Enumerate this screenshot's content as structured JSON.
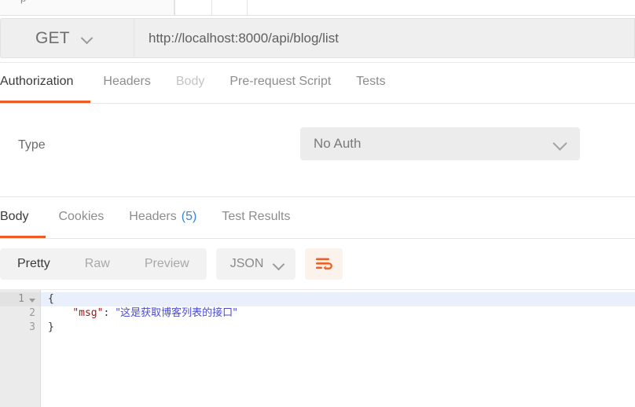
{
  "top_strip": {
    "ghost_text": "p"
  },
  "request": {
    "method": "GET",
    "url": "http://localhost:8000/api/blog/list",
    "tabs": [
      {
        "label": "Authorization",
        "state": "active"
      },
      {
        "label": "Headers",
        "state": "normal"
      },
      {
        "label": "Body",
        "state": "dim"
      },
      {
        "label": "Pre-request Script",
        "state": "normal"
      },
      {
        "label": "Tests",
        "state": "normal"
      }
    ]
  },
  "authorization": {
    "type_label": "Type",
    "selected_type": "No Auth"
  },
  "response": {
    "tabs": [
      {
        "label": "Body",
        "state": "active",
        "count": ""
      },
      {
        "label": "Cookies",
        "state": "normal",
        "count": ""
      },
      {
        "label": "Headers",
        "state": "normal",
        "count": "(5)"
      },
      {
        "label": "Test Results",
        "state": "normal",
        "count": ""
      }
    ],
    "format_modes": [
      {
        "label": "Pretty",
        "state": "active"
      },
      {
        "label": "Raw",
        "state": "normal"
      },
      {
        "label": "Preview",
        "state": "normal"
      }
    ],
    "language": "JSON",
    "wrap_icon": "word-wrap-icon",
    "body": {
      "line_numbers": [
        "1",
        "2",
        "3"
      ],
      "lines": [
        {
          "indent": "",
          "segments": [
            {
              "text": "{",
              "type": "punct"
            }
          ]
        },
        {
          "indent": "    ",
          "segments": [
            {
              "text": "\"msg\"",
              "type": "key"
            },
            {
              "text": ": ",
              "type": "punct"
            },
            {
              "text": "\"这是获取博客列表的接口\"",
              "type": "str"
            }
          ]
        },
        {
          "indent": "",
          "segments": [
            {
              "text": "}",
              "type": "punct"
            }
          ]
        }
      ]
    }
  },
  "colors": {
    "accent": "#ef5b25",
    "link": "#3a86d6",
    "json_key": "#a31515",
    "json_string": "#4a4ad8",
    "active_line": "#eaf0fb",
    "gutter": "#ebebeb"
  }
}
